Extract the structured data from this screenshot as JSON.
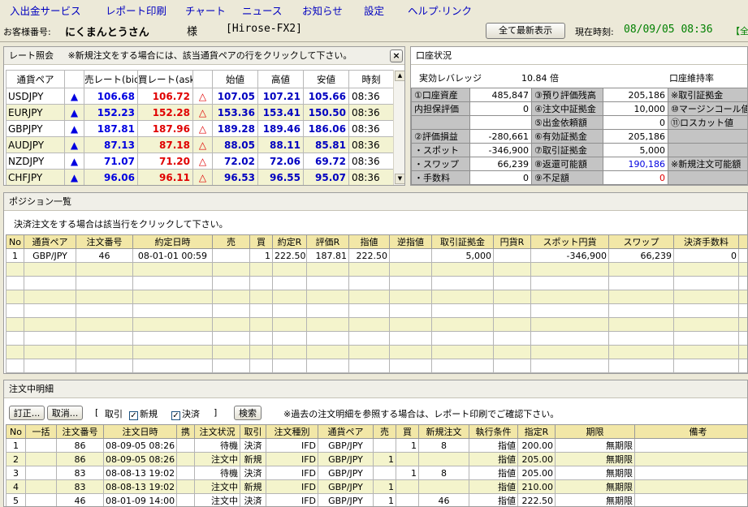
{
  "menu": [
    "入出金サービス",
    "レポート印刷",
    "チャート",
    "ニュース",
    "お知らせ",
    "設定",
    "ヘルプ·リンク"
  ],
  "header": {
    "customer_label": "お客様番号:",
    "customer_name": "にくまんとうさん",
    "suffix": "様",
    "server": "[Hirose-FX2]",
    "refresh_button": "全て最新表示",
    "time_label": "現在時刻:",
    "time_value": "08/09/05 08:36",
    "extra": "【全"
  },
  "rates": {
    "title": "レート照会",
    "note": "※新規注文をする場合には、該当通貨ペアの行をクリックして下さい。",
    "close": "×",
    "columns": [
      "通貨ペア",
      "",
      "売レート(bid)",
      "買レート(ask)",
      "",
      "始値",
      "高値",
      "安値",
      "時刻"
    ],
    "rows": [
      {
        "pair": "USDJPY",
        "bid_dir": "▲",
        "bid": "106.68",
        "ask": "106.72",
        "ask_dir": "△",
        "open": "107.05",
        "high": "107.21",
        "low": "105.66",
        "time": "08:36"
      },
      {
        "pair": "EURJPY",
        "bid_dir": "▲",
        "bid": "152.23",
        "ask": "152.28",
        "ask_dir": "△",
        "open": "153.36",
        "high": "153.41",
        "low": "150.50",
        "time": "08:36"
      },
      {
        "pair": "GBPJPY",
        "bid_dir": "▲",
        "bid": "187.81",
        "ask": "187.96",
        "ask_dir": "△",
        "open": "189.28",
        "high": "189.46",
        "low": "186.06",
        "time": "08:36"
      },
      {
        "pair": "AUDJPY",
        "bid_dir": "▲",
        "bid": "87.13",
        "ask": "87.18",
        "ask_dir": "△",
        "open": "88.05",
        "high": "88.11",
        "low": "85.81",
        "time": "08:36"
      },
      {
        "pair": "NZDJPY",
        "bid_dir": "▲",
        "bid": "71.07",
        "ask": "71.20",
        "ask_dir": "△",
        "open": "72.02",
        "high": "72.06",
        "low": "69.72",
        "time": "08:36"
      },
      {
        "pair": "CHFJPY",
        "bid_dir": "▲",
        "bid": "96.06",
        "ask": "96.11",
        "ask_dir": "△",
        "open": "96.53",
        "high": "96.55",
        "low": "95.07",
        "time": "08:36"
      }
    ]
  },
  "account": {
    "title": "口座状況",
    "leverage_label": "実効レバレッジ",
    "leverage_value": "10.84 倍",
    "maintain_label": "口座維持率",
    "rows": [
      [
        "①口座資産",
        "485,847",
        "③預り評価残高",
        "205,186",
        "※取引証拠金"
      ],
      [
        "内担保評価",
        "0",
        "④注文中証拠金",
        "10,000",
        "⑩マージンコール値"
      ],
      [
        "",
        "",
        "⑤出金依頼額",
        "0",
        "⑪ロスカット値"
      ],
      [
        "②評価損益",
        "-280,661",
        "⑥有効証拠金",
        "205,186",
        ""
      ],
      [
        "・スポット",
        "-346,900",
        "⑦取引証拠金",
        "5,000",
        ""
      ],
      [
        "・スワップ",
        "66,239",
        "⑧返還可能額",
        "190,186",
        "※新規注文可能額"
      ],
      [
        "・手数料",
        "0",
        "⑨不足額",
        "0",
        ""
      ]
    ]
  },
  "positions": {
    "title": "ポジション一覧",
    "note": "決済注文をする場合は該当行をクリックして下さい。",
    "columns": [
      "No",
      "通貨ペア",
      "注文番号",
      "約定日時",
      "売",
      "買",
      "約定R",
      "評価R",
      "指値",
      "逆指値",
      "取引証拠金",
      "円貨R",
      "スポット円貨",
      "スワップ",
      "決済手数料",
      "決"
    ],
    "rows": [
      [
        "1",
        "GBP/JPY",
        "46",
        "08-01-01 00:59",
        "",
        "1",
        "222.50",
        "187.81",
        "222.50",
        "",
        "5,000",
        "",
        "-346,900",
        "66,239",
        "0",
        ""
      ]
    ]
  },
  "orders": {
    "title": "注文中明細",
    "edit_button": "訂正...",
    "cancel_button": "取消...",
    "filter_open": "[",
    "filter_trade": "取引",
    "filter_new": "新規",
    "filter_close": "決済",
    "filter_end": "]",
    "search_button": "検索",
    "note": "※過去の注文明細を参照する場合は、レポート印刷でご確認下さい。",
    "columns": [
      "No",
      "一括",
      "注文番号",
      "注文日時",
      "携",
      "注文状況",
      "取引",
      "注文種別",
      "通貨ペア",
      "売",
      "買",
      "新規注文",
      "執行条件",
      "指定R",
      "期限",
      "備考"
    ],
    "rows": [
      [
        "1",
        "",
        "86",
        "08-09-05 08:26",
        "",
        "待機",
        "決済",
        "IFD",
        "GBP/JPY",
        "",
        "1",
        "8",
        "指値",
        "200.00",
        "無期限",
        ""
      ],
      [
        "2",
        "",
        "86",
        "08-09-05 08:26",
        "",
        "注文中",
        "新規",
        "IFD",
        "GBP/JPY",
        "1",
        "",
        "",
        "指値",
        "205.00",
        "無期限",
        ""
      ],
      [
        "3",
        "",
        "83",
        "08-08-13 19:02",
        "",
        "待機",
        "決済",
        "IFD",
        "GBP/JPY",
        "",
        "1",
        "8",
        "指値",
        "205.00",
        "無期限",
        ""
      ],
      [
        "4",
        "",
        "83",
        "08-08-13 19:02",
        "",
        "注文中",
        "新規",
        "IFD",
        "GBP/JPY",
        "1",
        "",
        "",
        "指値",
        "210.00",
        "無期限",
        ""
      ],
      [
        "5",
        "",
        "46",
        "08-01-09 14:00",
        "",
        "注文中",
        "決済",
        "IFD",
        "GBP/JPY",
        "1",
        "",
        "46",
        "指値",
        "222.50",
        "無期限",
        ""
      ]
    ]
  },
  "colors": {
    "bid": "#0000e0",
    "ask": "#e00000",
    "row_alt": "#f4f4cc",
    "header_gold": "#f2e7a7",
    "menu_text": "#0000c0",
    "clock": "#008000"
  }
}
